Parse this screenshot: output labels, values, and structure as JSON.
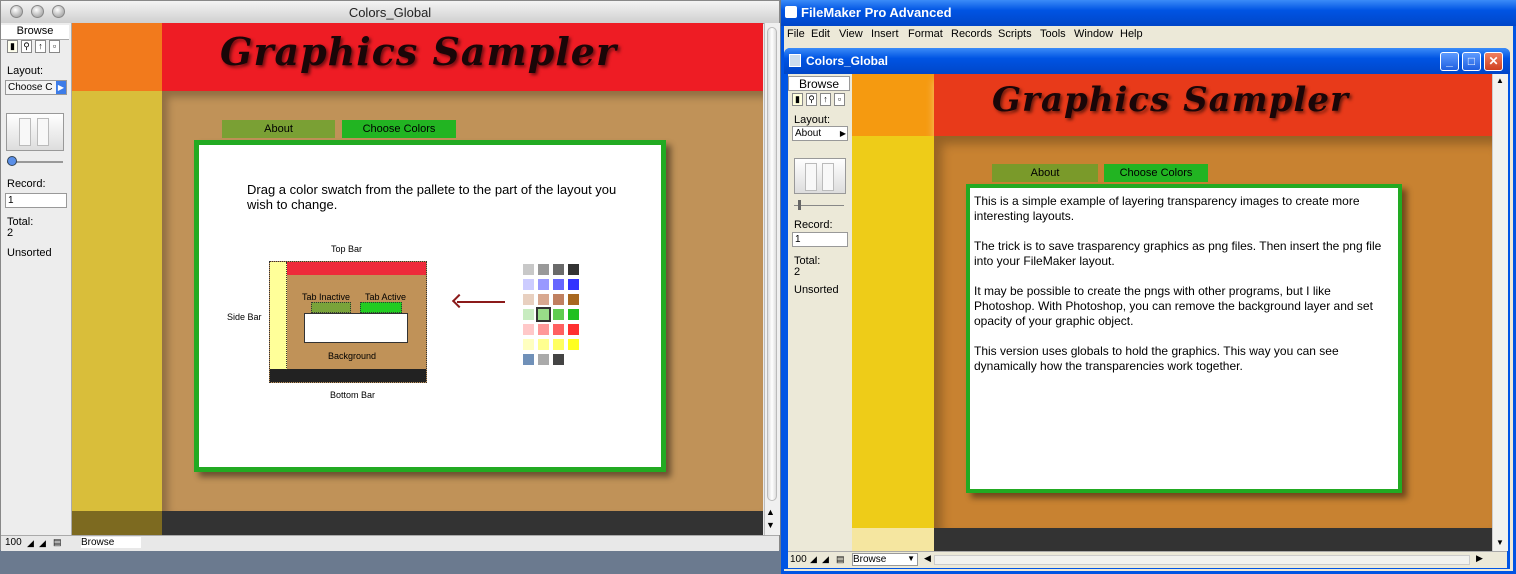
{
  "mac_window": {
    "title": "Colors_Global",
    "sidebar": {
      "mode": "Browse",
      "layout_label": "Layout:",
      "layout_value": "Choose C",
      "record_label": "Record:",
      "record_value": "1",
      "total_label": "Total:",
      "total_value": "2",
      "sort_status": "Unsorted"
    },
    "status": {
      "zoom": "100",
      "mode": "Browse"
    },
    "layout": {
      "title": "Graphics Sampler",
      "tabs": [
        {
          "label": "About"
        },
        {
          "label": "Choose Colors"
        }
      ],
      "instruction": "Drag a color swatch from the pallete to the part of the layout you wish to change.",
      "diagram": {
        "top_bar": "Top Bar",
        "side_bar": "Side Bar",
        "tab_inactive": "Tab Inactive",
        "tab_active": "Tab Active",
        "background": "Background",
        "bottom_bar": "Bottom Bar"
      },
      "palette": [
        [
          "#c8c8c8",
          "#999999",
          "#6a6a6a",
          "#333333"
        ],
        [
          "#ccccff",
          "#9999ff",
          "#6666ff",
          "#3333ff"
        ],
        [
          "#e8d0c0",
          "#d8a890",
          "#c08060",
          "#a86820"
        ],
        [
          "#c8ecc0",
          "#98dc88",
          "#60cc50",
          "#20c020"
        ],
        [
          "#ffc8c8",
          "#ff9898",
          "#ff6060",
          "#ff3030"
        ],
        [
          "#ffffc0",
          "#ffff90",
          "#ffff60",
          "#ffff20"
        ],
        [
          "#7090b8",
          "#aaaaaa",
          "#444444"
        ]
      ]
    }
  },
  "win_window": {
    "app_title": "FileMaker Pro Advanced",
    "menus": [
      "File",
      "Edit",
      "View",
      "Insert",
      "Format",
      "Records",
      "Scripts",
      "Tools",
      "Window",
      "Help"
    ],
    "doc_title": "Colors_Global",
    "sidebar": {
      "mode": "Browse",
      "layout_label": "Layout:",
      "layout_value": "About",
      "record_label": "Record:",
      "record_value": "1",
      "total_label": "Total:",
      "total_value": "2",
      "sort_status": "Unsorted"
    },
    "status": {
      "zoom": "100",
      "mode": "Browse"
    },
    "layout": {
      "title": "Graphics Sampler",
      "tabs": [
        {
          "label": "About"
        },
        {
          "label": "Choose Colors"
        }
      ],
      "paragraphs": [
        "This is a simple example of layering transparency images to create more interesting layouts.",
        "The trick is to save trasparency graphics as png files.  Then insert the png file into your FileMaker layout.",
        "It may be possible to create the pngs with other programs, but I like Photoshop.  With Photoshop, you can remove the background layer and set opacity of your graphic object.",
        "This version uses globals to hold the graphics.  This way you can see dynamically how the transparencies work together."
      ]
    }
  },
  "colors": {
    "mac_top_orange": "#f27a1c",
    "mac_top_red": "#ee1c24",
    "mac_side_yellow": "#d9be3a",
    "mac_bg": "#c09258",
    "mac_bottom": "#333333",
    "mac_green": "#22aa22",
    "win_top_orange": "#f59a10",
    "win_top_red": "#e83a1a",
    "win_side_yellow": "#eecc18",
    "win_bg": "#c88231",
    "win_bottom": "#333333"
  }
}
